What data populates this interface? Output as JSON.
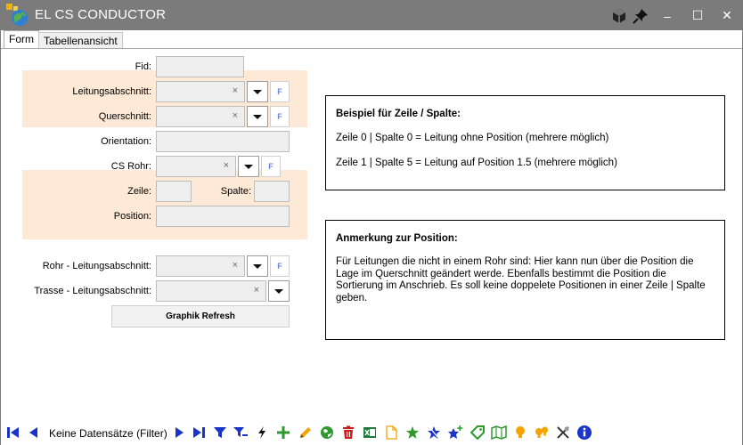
{
  "window": {
    "title": "EL CS CONDUCTOR",
    "close_glyph": "✕",
    "minimize_glyph": "–",
    "maximize_glyph": "☐"
  },
  "tabs": [
    {
      "label": "Form"
    },
    {
      "label": "Tabellenansicht"
    }
  ],
  "form": {
    "fid_label": "Fid:",
    "leitungsabschnitt_label": "Leitungsabschnitt:",
    "querschnitt_label": "Querschnitt:",
    "orientation_label": "Orientation:",
    "cs_rohr_label": "CS Rohr:",
    "zeile_label": "Zeile:",
    "spalte_label": "Spalte:",
    "position_label": "Position:",
    "rohr_leitungsabschnitt_label": "Rohr - Leitungsabschnitt:",
    "trasse_leitungsabschnitt_label": "Trasse - Leitungsabschnitt:",
    "clear_glyph": "×",
    "f_button_label": "F",
    "graphik_refresh_label": "Graphik Refresh"
  },
  "info_box_1": {
    "heading": "Beispiel für Zeile / Spalte:",
    "line1": "Zeile 0 | Spalte 0 = Leitung ohne Position (mehrere möglich)",
    "line2": "Zeile 1 | Spalte 5 = Leitung auf Position 1.5 (mehrere möglich)"
  },
  "info_box_2": {
    "heading": "Anmerkung zur Position:",
    "body": "Für Leitungen die nicht in einem Rohr sind: Hier kann nun über die Position die Lage im Querschnitt geändert werde. Ebenfalls bestimmt die Position die Sortierung im Anschrieb. Es soll keine doppelete Positionen in einer Zeile | Spalte geben."
  },
  "toolbar": {
    "record_status": "Keine Datensätze (Filter)"
  },
  "colors": {
    "titlebar": "#7b7b7b",
    "band": "#fde9d5",
    "nav_blue": "#1a33c9",
    "add_green": "#2e9a2e",
    "delete_red": "#c81e1e",
    "edit_orange": "#f5a300"
  },
  "icons": [
    "cube-icon",
    "pin-icon",
    "first-record-icon",
    "previous-record-icon",
    "next-record-icon",
    "last-record-icon",
    "filter-icon",
    "clear-filter-icon",
    "lightning-icon",
    "add-icon",
    "edit-icon",
    "globe-icon",
    "delete-icon",
    "excel-icon",
    "new-document-icon",
    "star-icon",
    "star-new-icon",
    "star-add-icon",
    "tag-icon",
    "map-icon",
    "lightbulb-icon",
    "lightbulbs-icon",
    "tools-icon",
    "info-icon"
  ]
}
